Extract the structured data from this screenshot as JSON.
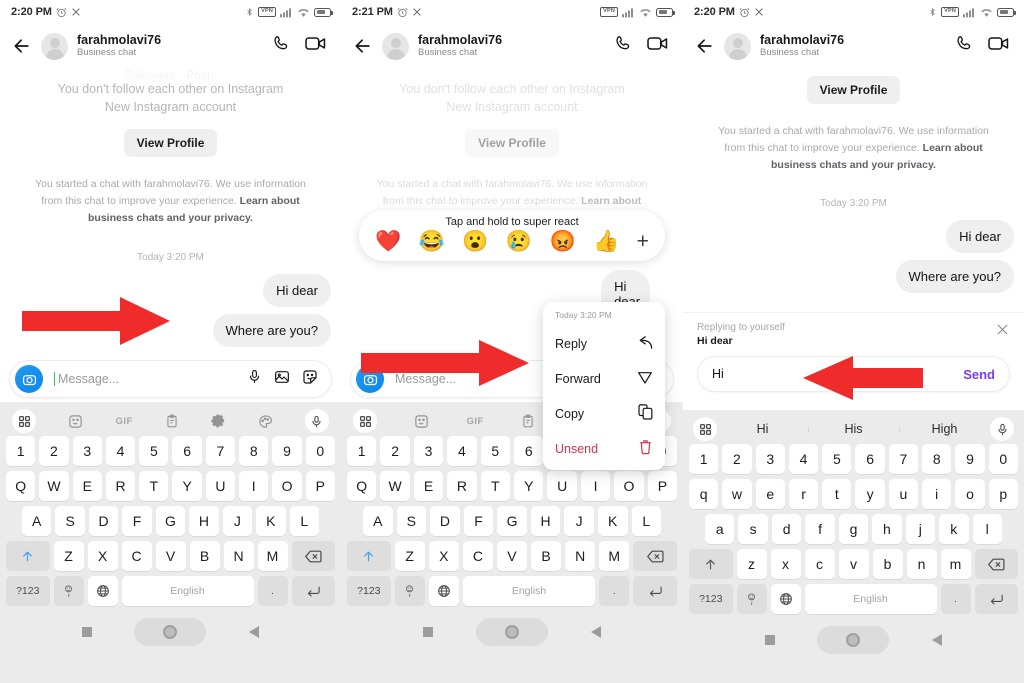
{
  "app": {
    "name": "Instagram Direct",
    "accent_send": "#7b3df5",
    "arrow_color": "#ef2b2b",
    "bubble_bg": "#efeff0"
  },
  "panels": [
    {
      "id": "panel-1",
      "status": {
        "time": "2:20 PM",
        "icons": [
          "alarm-icon",
          "close-icon",
          "bluetooth-icon",
          "vpn-icon",
          "signal-icon",
          "wifi-icon",
          "battery-icon"
        ]
      },
      "header": {
        "username": "farahmolavi76",
        "subtitle": "Business chat",
        "back": "back-arrow-icon",
        "call": "phone-icon",
        "video": "video-camera-icon"
      },
      "profile_faded": "Followers · Posts",
      "sys_follow_line1": "You don't follow each other on Instagram",
      "sys_follow_line2": "New Instagram account",
      "view_profile": "View Profile",
      "sys_note_plain": "You started a chat with farahmolavi76. We use information from this chat to improve your experience. ",
      "sys_note_link": "Learn about business chats and your privacy.",
      "daystamp": "Today 3:20 PM",
      "messages": [
        {
          "text": "Hi dear",
          "side": "out"
        },
        {
          "text": "Where are you?",
          "side": "out"
        }
      ],
      "composer": {
        "placeholder": "Message...",
        "camera": "camera-icon",
        "mic": "microphone-icon",
        "gallery": "gallery-icon",
        "sticker": "sticker-icon"
      },
      "keyboard": {
        "toolbar": [
          "grid-icon",
          "sticker-icon",
          "GIF",
          "clipboard-icon",
          "gear-icon",
          "palette-icon",
          "microphone-icon"
        ],
        "row_numbers": [
          "1",
          "2",
          "3",
          "4",
          "5",
          "6",
          "7",
          "8",
          "9",
          "0"
        ],
        "row_top": [
          "Q",
          "W",
          "E",
          "R",
          "T",
          "Y",
          "U",
          "I",
          "O",
          "P"
        ],
        "row_home": [
          "A",
          "S",
          "D",
          "F",
          "G",
          "H",
          "J",
          "K",
          "L"
        ],
        "row_bottom": [
          "Z",
          "X",
          "C",
          "V",
          "B",
          "N",
          "M"
        ],
        "shift": "shift-up-icon",
        "backspace": "backspace-icon",
        "symbols": "?123",
        "emoji": "emoji-comma-key",
        "globe": "globe-icon",
        "space": "English",
        "period": ".",
        "enter": "enter-icon"
      },
      "nav": {
        "recents": "square-icon",
        "home": "home-circle-icon",
        "back": "triangle-back-icon"
      },
      "arrow": {
        "name": "red-arrow-right",
        "direction": "right"
      }
    },
    {
      "id": "panel-2",
      "status": {
        "time": "2:21 PM",
        "icons": [
          "alarm-icon",
          "close-icon",
          "vpn-icon",
          "signal-icon",
          "wifi-icon",
          "battery-icon"
        ]
      },
      "header": {
        "username": "farahmolavi76",
        "subtitle": "Business chat"
      },
      "sys_follow_line1": "You don't follow each other on Instagram",
      "sys_follow_line2": "New Instagram account",
      "view_profile": "View Profile",
      "sys_note_plain": "You started a chat with farahmolavi76. We use information from this chat to improve your experience. ",
      "sys_note_link": "Learn about business chats and your privacy.",
      "reaction_bar": {
        "title": "Tap and hold to super react",
        "emojis": [
          "❤️",
          "😂",
          "😮",
          "😢",
          "😡",
          "👍"
        ],
        "plus": "+"
      },
      "messages": [
        {
          "text": "Hi dear",
          "side": "out"
        }
      ],
      "context_menu": {
        "timestamp": "Today 3:20 PM",
        "items": [
          {
            "label": "Reply",
            "icon": "reply-arrow-icon",
            "danger": false
          },
          {
            "label": "Forward",
            "icon": "forward-send-icon",
            "danger": false
          },
          {
            "label": "Copy",
            "icon": "copy-icon",
            "danger": false
          },
          {
            "label": "Unsend",
            "icon": "trash-icon",
            "danger": true
          }
        ]
      },
      "composer": {
        "placeholder": "Message...",
        "camera": "camera-icon"
      },
      "arrow": {
        "name": "red-arrow-right",
        "direction": "right"
      }
    },
    {
      "id": "panel-3",
      "status": {
        "time": "2:20 PM",
        "icons": [
          "alarm-icon",
          "close-icon",
          "bluetooth-icon",
          "vpn-icon",
          "signal-icon",
          "wifi-icon",
          "battery-icon"
        ]
      },
      "header": {
        "username": "farahmolavi76",
        "subtitle": "Business chat"
      },
      "view_profile": "View Profile",
      "sys_note_plain": "You started a chat with farahmolavi76. We use information from this chat to improve your experience. ",
      "sys_note_link": "Learn about business chats and your privacy.",
      "daystamp": "Today 3:20 PM",
      "messages": [
        {
          "text": "Hi dear",
          "side": "out"
        },
        {
          "text": "Where are you?",
          "side": "out"
        }
      ],
      "reply_preview": {
        "label": "Replying to yourself",
        "quoted": "Hi dear",
        "close": "close-icon"
      },
      "send_bar": {
        "value": "Hi",
        "send_label": "Send"
      },
      "keyboard": {
        "suggestions": [
          "Hi",
          "His",
          "High"
        ],
        "row_numbers": [
          "1",
          "2",
          "3",
          "4",
          "5",
          "6",
          "7",
          "8",
          "9",
          "0"
        ],
        "row_top": [
          "q",
          "w",
          "e",
          "r",
          "t",
          "y",
          "u",
          "i",
          "o",
          "p"
        ],
        "row_home": [
          "a",
          "s",
          "d",
          "f",
          "g",
          "h",
          "j",
          "k",
          "l"
        ],
        "row_bottom": [
          "z",
          "x",
          "c",
          "v",
          "b",
          "n",
          "m"
        ],
        "symbols": "?123",
        "space": "English",
        "period": "."
      },
      "arrow": {
        "name": "red-arrow-left",
        "direction": "left"
      }
    }
  ]
}
